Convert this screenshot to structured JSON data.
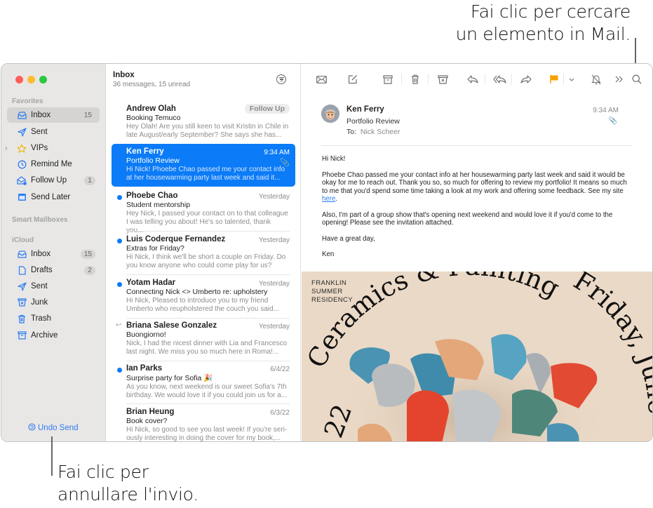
{
  "callouts": {
    "search": [
      "Fai clic per cercare",
      "un elemento in Mail."
    ],
    "undo": [
      "Fai clic per",
      "annullare l'invio."
    ]
  },
  "sidebar": {
    "favorites_label": "Favorites",
    "favorites": [
      {
        "label": "Inbox",
        "icon": "inbox-icon",
        "badge": "15",
        "active": true
      },
      {
        "label": "Sent",
        "icon": "paper-plane-icon",
        "badge": null
      },
      {
        "label": "VIPs",
        "icon": "star-icon",
        "badge": null
      },
      {
        "label": "Remind Me",
        "icon": "clock-icon",
        "badge": null
      },
      {
        "label": "Follow Up",
        "icon": "follow-up-envelope-icon",
        "badge": "1"
      },
      {
        "label": "Send Later",
        "icon": "calendar-icon",
        "badge": null
      }
    ],
    "smart_label": "Smart Mailboxes",
    "icloud_label": "iCloud",
    "icloud": [
      {
        "label": "Inbox",
        "icon": "inbox-icon",
        "badge": "15"
      },
      {
        "label": "Drafts",
        "icon": "document-icon",
        "badge": "2"
      },
      {
        "label": "Sent",
        "icon": "paper-plane-icon",
        "badge": null
      },
      {
        "label": "Junk",
        "icon": "junk-icon",
        "badge": null
      },
      {
        "label": "Trash",
        "icon": "trash-icon",
        "badge": null
      },
      {
        "label": "Archive",
        "icon": "archive-icon",
        "badge": null
      }
    ],
    "undo_send": "Undo Send"
  },
  "list": {
    "title": "Inbox",
    "subtitle": "36 messages, 15 unread",
    "messages": [
      {
        "sender": "Andrew Olah",
        "date": "",
        "tag": "Follow Up",
        "subject": "Booking Temuco",
        "preview": [
          "Hey Olah! Are you still keen to visit Kristin in Chile in",
          "late August/early September? She says she has..."
        ],
        "unread": false
      },
      {
        "sender": "Ken Ferry",
        "date": "9:34 AM",
        "subject": "Portfolio Review",
        "preview": [
          "Hi Nick! Phoebe Chao passed me your contact info",
          "at her housewarming party last week and said it..."
        ],
        "unread": false,
        "selected": true,
        "attachment": true
      },
      {
        "sender": "Phoebe Chao",
        "date": "Yesterday",
        "subject": "Student mentorship",
        "preview": [
          "Hey Nick, I passed your contact on to that colleague",
          "I was telling you about! He's so talented, thank you..."
        ],
        "unread": true
      },
      {
        "sender": "Luis Coderque Fernandez",
        "date": "Yesterday",
        "subject": "Extras for Friday?",
        "preview": [
          "Hi Nick, I think we'll be short a couple on Friday. Do",
          "you know anyone who could come play for us?"
        ],
        "unread": true
      },
      {
        "sender": "Yotam Hadar",
        "date": "Yesterday",
        "subject": "Connecting Nick <> Umberto re: upholstery",
        "preview": [
          "Hi Nick, Pleased to introduce you to my friend",
          "Umberto who reupholstered the couch you said..."
        ],
        "unread": true
      },
      {
        "sender": "Briana Salese Gonzalez",
        "date": "Yesterday",
        "subject": "Buongiorno!",
        "preview": [
          "Nick, I had the nicest dinner with Lia and Francesco",
          "last night. We miss you so much here in Roma!..."
        ],
        "unread": false,
        "replied": true
      },
      {
        "sender": "Ian Parks",
        "date": "6/4/22",
        "subject": "Surprise party for Sofia 🎉",
        "preview": [
          "As you know, next weekend is our sweet Sofia's 7th",
          "birthday. We would love it if you could join us for a..."
        ],
        "unread": true
      },
      {
        "sender": "Brian Heung",
        "date": "6/3/22",
        "subject": "Book cover?",
        "preview": [
          "Hi Nick, so good to see you last week! If you're seri-",
          "ously interesting in doing the cover for my book,..."
        ],
        "unread": false
      }
    ]
  },
  "toolbar": [
    "envelope-icon",
    "compose-icon",
    "archive-icon",
    "trash-icon",
    "junk-icon",
    "reply-icon",
    "reply-all-icon",
    "forward-icon",
    "flag-icon",
    "flag-menu-chevron-icon",
    "mute-bell-icon",
    "more-chevrons-icon",
    "search-icon"
  ],
  "flag_color": "#f7a000",
  "reader": {
    "from": "Ken Ferry",
    "subject": "Portfolio Review",
    "to_label": "To:",
    "to": "Nick Scheer",
    "time": "9:34 AM",
    "body": {
      "greeting": "Hi Nick!",
      "p1": "Phoebe Chao passed me your contact info at her housewarming party last week and said it would be okay for me to reach out. Thank you so, so much for offering to review my portfolio! It means so much to me that you'd spend some time taking a look at my work and offering some feedback. See my site ",
      "link": "here",
      "p2": "Also, I'm part of a group show that's opening next weekend and would love it if you'd come to the opening! Please see the invitation attached.",
      "closing": "Have a great day,",
      "signature": "Ken"
    },
    "invite": {
      "residency": [
        "FRANKLIN",
        "SUMMER",
        "RESIDENCY"
      ],
      "arc_title": "Ceramics & Painting",
      "arc_date": "Friday, June",
      "year": "22"
    }
  }
}
